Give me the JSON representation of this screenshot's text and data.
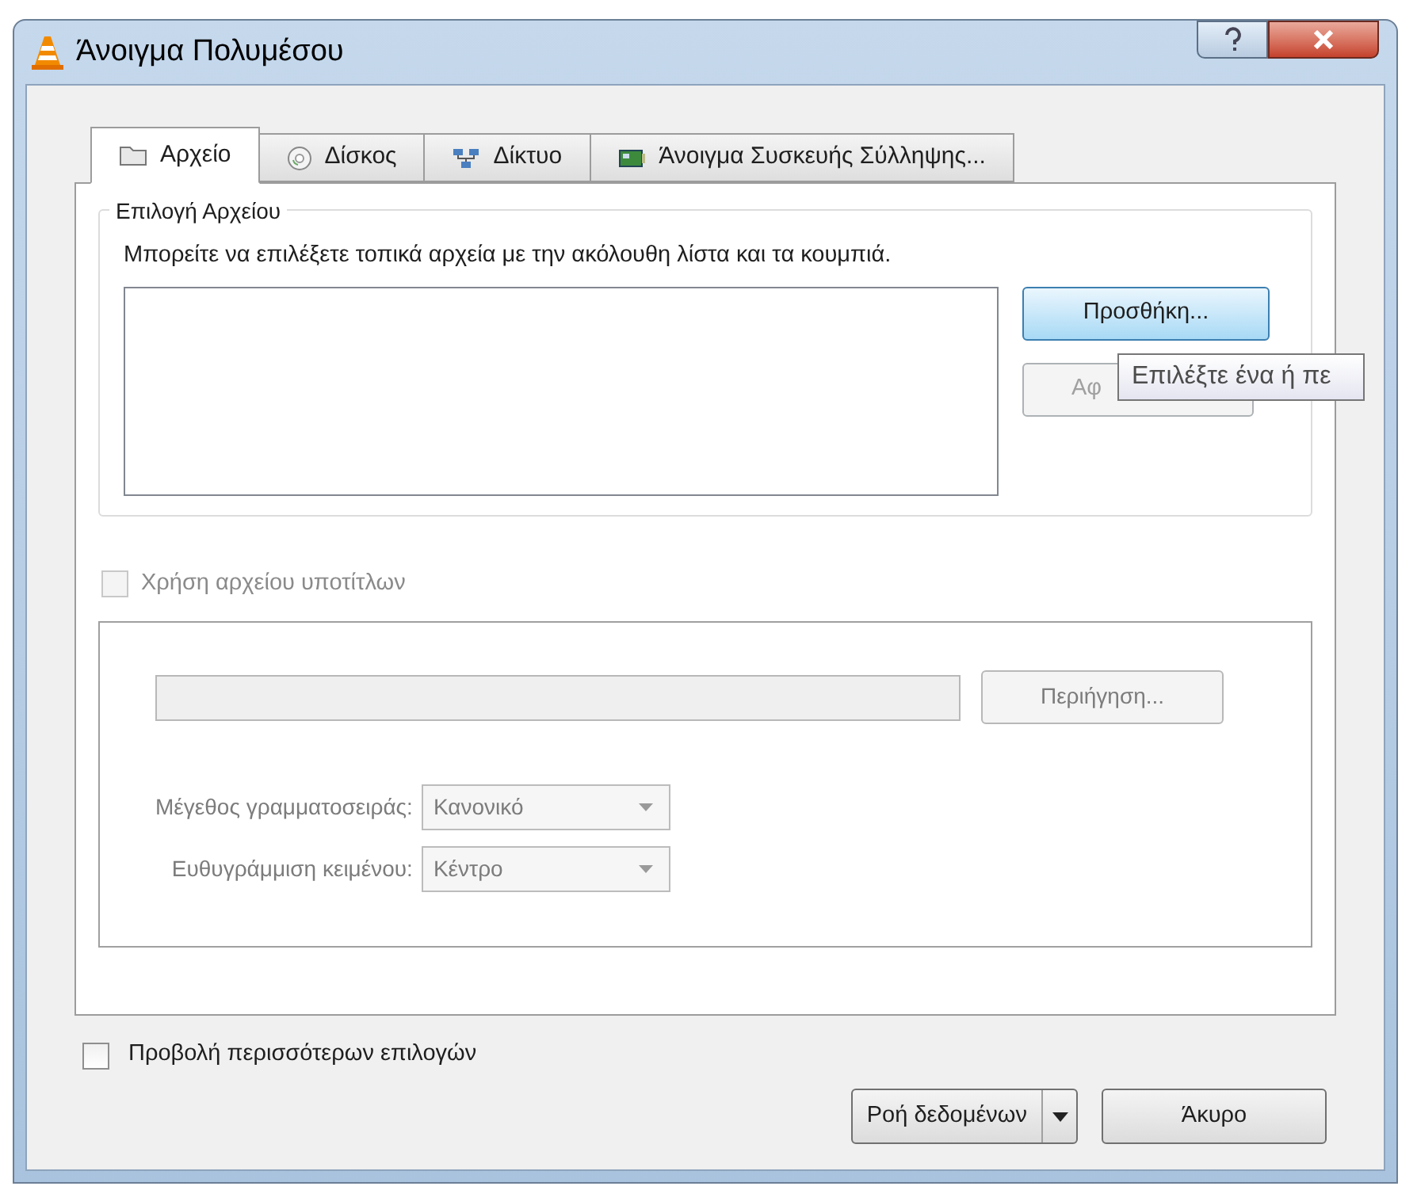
{
  "window": {
    "title": "Άνοιγμα Πολυμέσου"
  },
  "tabs": [
    {
      "label": "Αρχείο",
      "kind": "file",
      "selected": true
    },
    {
      "label": "Δίσκος",
      "kind": "disc",
      "selected": false
    },
    {
      "label": "Δίκτυο",
      "kind": "network",
      "selected": false
    },
    {
      "label": "Άνοιγμα Συσκευής Σύλληψης...",
      "kind": "capture",
      "selected": false
    }
  ],
  "file_group": {
    "title": "Επιλογή Αρχείου",
    "description": "Μπορείτε να επιλέξετε τοπικά αρχεία με την ακόλουθη λίστα και τα κουμπιά.",
    "add_button": {
      "label": "Προσθήκη...",
      "hovered": true
    },
    "remove_button": {
      "label": "Αφ",
      "disabled": true
    },
    "tooltip": "Επιλέξτε ένα ή πε"
  },
  "subtitles": {
    "label": "Χρήση αρχείου υποτίτλων",
    "checked": false,
    "disabled": true,
    "browse_button": "Περιήγηση...",
    "fields": [
      {
        "label": "Μέγεθος γραμματοσειράς:",
        "value": "Κανονικό"
      },
      {
        "label": "Ευθυγράμμιση κειμένου:",
        "value": "Κέντρο"
      }
    ]
  },
  "more_options": {
    "label": "Προβολή περισσότερων επιλογών",
    "checked": false
  },
  "buttons": {
    "stream": "Ροή δεδομένων",
    "cancel": "Άκυρο"
  }
}
